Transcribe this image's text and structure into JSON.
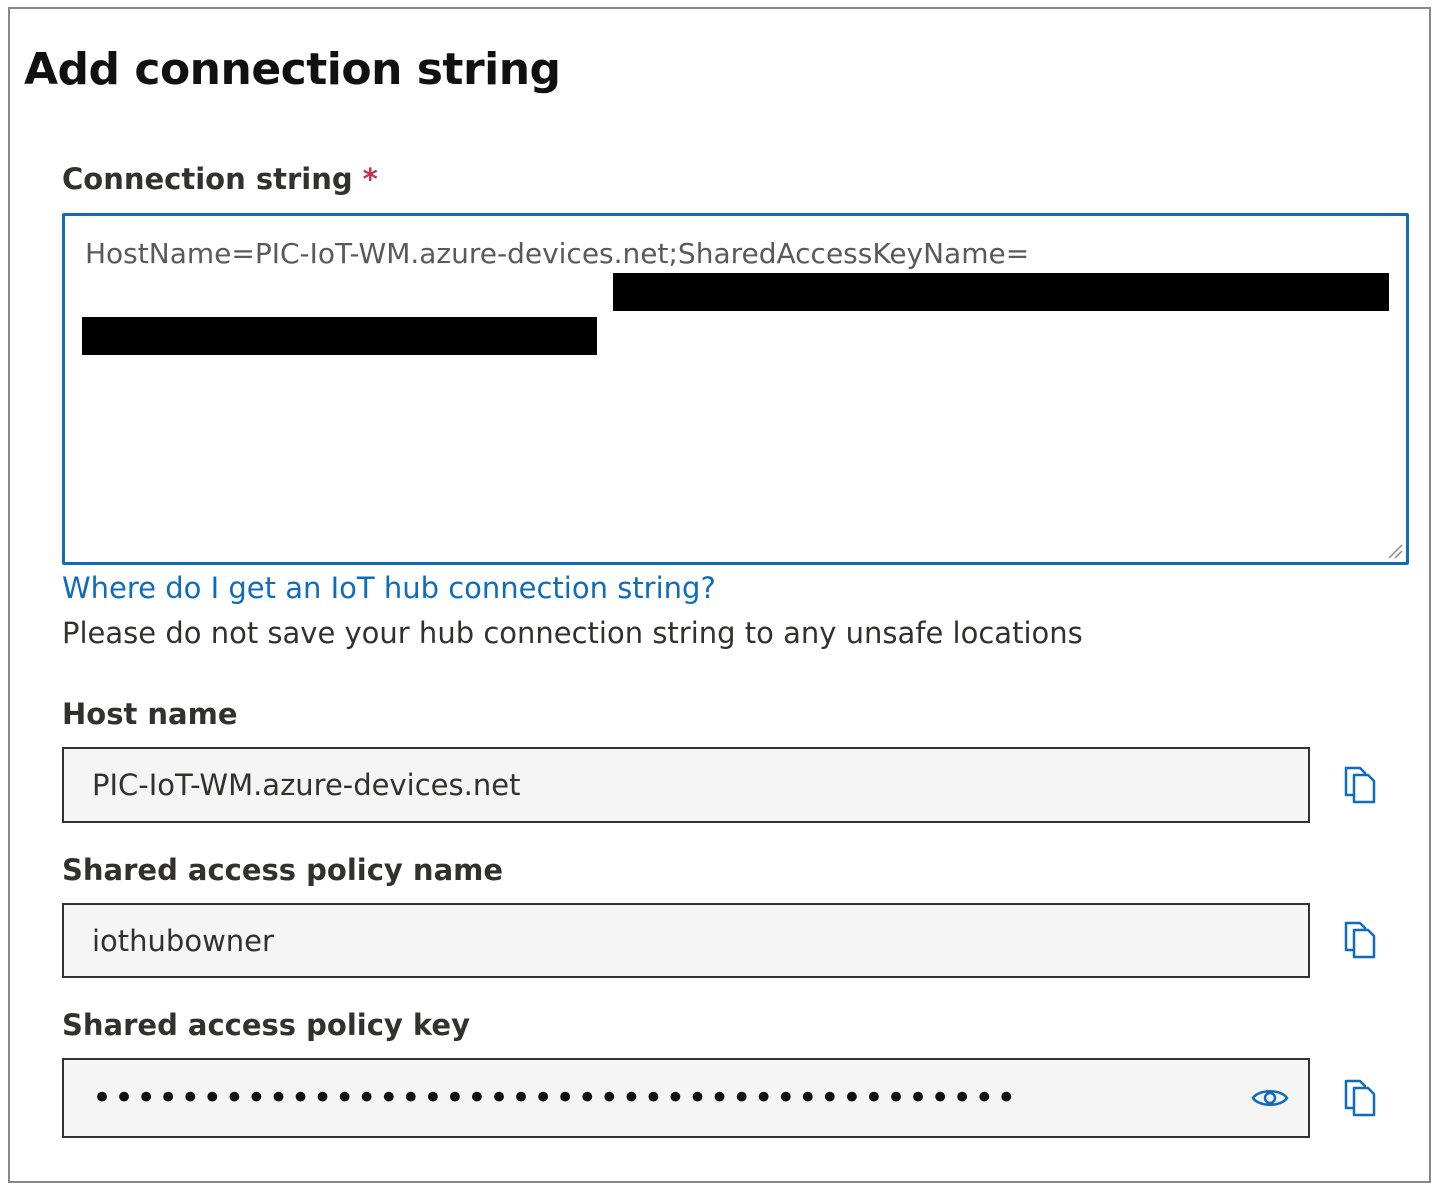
{
  "dialog": {
    "title": "Add connection string"
  },
  "connection_string": {
    "label": "Connection string",
    "required_marker": "*",
    "value": "HostName=PIC-IoT-WM.azure-devices.net;SharedAccessKeyName="
  },
  "help_link": {
    "text": "Where do I get an IoT hub connection string?"
  },
  "warning": {
    "text": "Please do not save your hub connection string to any unsafe locations"
  },
  "host_name": {
    "label": "Host name",
    "value": "PIC-IoT-WM.azure-devices.net"
  },
  "policy_name": {
    "label": "Shared access policy name",
    "value": "iothubowner"
  },
  "policy_key": {
    "label": "Shared access policy key",
    "masked_value": "••••••••••••••••••••••••••••••••••••••••••"
  },
  "icons": {
    "copy": "copy-icon",
    "reveal": "eye-icon"
  },
  "colors": {
    "accent": "#0f6cbd",
    "required": "#c4314b",
    "readonly_bg": "#f5f5f5"
  }
}
